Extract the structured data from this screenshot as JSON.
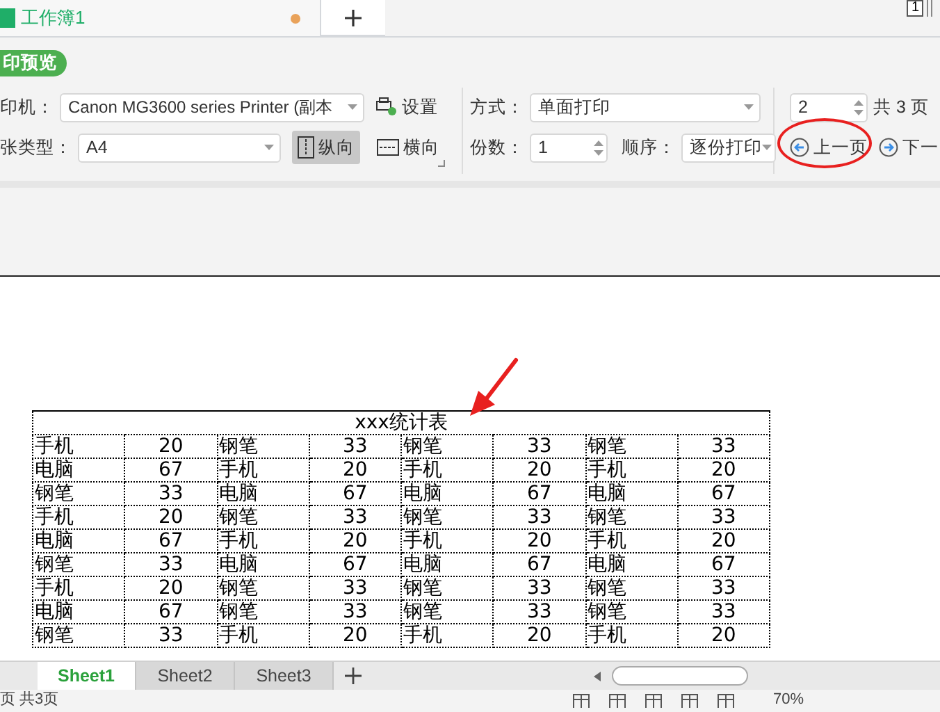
{
  "window": {
    "tabs": [
      {
        "label": "工作簿1",
        "selected": true,
        "unsaved": true
      }
    ],
    "view_badge": "1"
  },
  "preview_button": "印预览",
  "toolbar": {
    "printer": {
      "label": "印机：",
      "value": "Canon MG3600 series Printer (副本"
    },
    "settings_button": "设置",
    "paper": {
      "label": "张类型：",
      "value": "A4"
    },
    "orientation": [
      {
        "label": "纵向",
        "selected": true,
        "kind": "portrait"
      },
      {
        "label": "横向",
        "selected": false,
        "kind": "landscape"
      }
    ],
    "duplex": {
      "label": "方式：",
      "value": "单面打印"
    },
    "copies": {
      "label": "份数：",
      "value": "1"
    },
    "order": {
      "label": "顺序：",
      "value": "逐份打印"
    },
    "page": {
      "value": "2",
      "total": "共 3 页"
    },
    "nav": [
      {
        "label": "上一页",
        "kind": "prev"
      },
      {
        "label": "下一",
        "kind": "next"
      }
    ]
  },
  "table": {
    "title": "xxx统计表",
    "rows": [
      [
        "手机",
        "20",
        "钢笔",
        "33",
        "钢笔",
        "33",
        "钢笔",
        "33"
      ],
      [
        "电脑",
        "67",
        "手机",
        "20",
        "手机",
        "20",
        "手机",
        "20"
      ],
      [
        "钢笔",
        "33",
        "电脑",
        "67",
        "电脑",
        "67",
        "电脑",
        "67"
      ],
      [
        "手机",
        "20",
        "钢笔",
        "33",
        "钢笔",
        "33",
        "钢笔",
        "33"
      ],
      [
        "电脑",
        "67",
        "手机",
        "20",
        "手机",
        "20",
        "手机",
        "20"
      ],
      [
        "钢笔",
        "33",
        "电脑",
        "67",
        "电脑",
        "67",
        "电脑",
        "67"
      ],
      [
        "手机",
        "20",
        "钢笔",
        "33",
        "钢笔",
        "33",
        "钢笔",
        "33"
      ],
      [
        "电脑",
        "67",
        "钢笔",
        "33",
        "钢笔",
        "33",
        "钢笔",
        "33"
      ],
      [
        "钢笔",
        "33",
        "手机",
        "20",
        "手机",
        "20",
        "手机",
        "20"
      ]
    ]
  },
  "sheet_tabs": [
    {
      "label": "Sheet1",
      "selected": true
    },
    {
      "label": "Sheet2",
      "selected": false
    },
    {
      "label": "Sheet3",
      "selected": false
    }
  ],
  "status_bar": {
    "pages": "页 共3页",
    "zoom": "70%"
  }
}
